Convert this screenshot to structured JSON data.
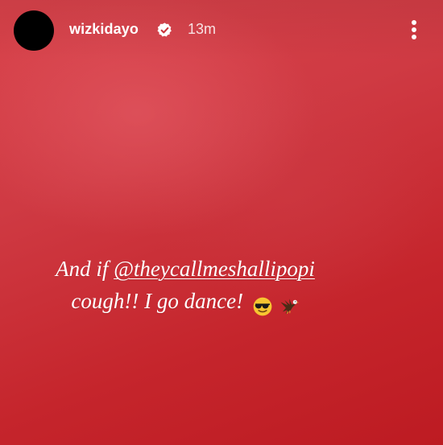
{
  "header": {
    "username": "wizkidayo",
    "time_ago": "13m",
    "verified_icon": "verified-badge-icon",
    "more_icon": "more-vertical-icon"
  },
  "caption": {
    "line1_prefix": "And if ",
    "mention": "@theycallmeshallipopi",
    "line2": "cough!! I go dance!",
    "emojis": [
      "smiling-face-with-sunglasses-emoji",
      "eagle-emoji"
    ]
  },
  "colors": {
    "background_top": "#d8424a",
    "background_bottom": "#bd1b22",
    "text": "#ffffff"
  }
}
